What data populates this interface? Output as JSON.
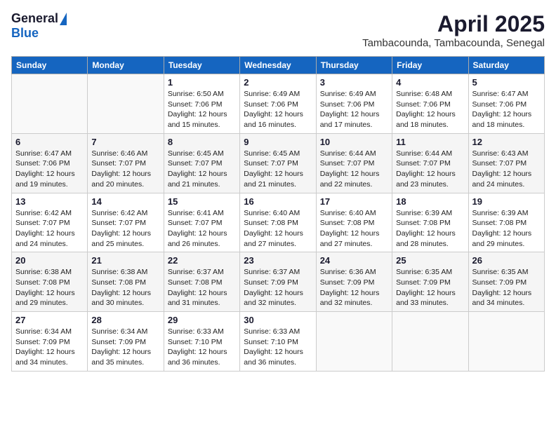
{
  "header": {
    "logo_general": "General",
    "logo_blue": "Blue",
    "title": "April 2025",
    "location": "Tambacounda, Tambacounda, Senegal"
  },
  "weekdays": [
    "Sunday",
    "Monday",
    "Tuesday",
    "Wednesday",
    "Thursday",
    "Friday",
    "Saturday"
  ],
  "weeks": [
    [
      {
        "day": "",
        "info": ""
      },
      {
        "day": "",
        "info": ""
      },
      {
        "day": "1",
        "info": "Sunrise: 6:50 AM\nSunset: 7:06 PM\nDaylight: 12 hours and 15 minutes."
      },
      {
        "day": "2",
        "info": "Sunrise: 6:49 AM\nSunset: 7:06 PM\nDaylight: 12 hours and 16 minutes."
      },
      {
        "day": "3",
        "info": "Sunrise: 6:49 AM\nSunset: 7:06 PM\nDaylight: 12 hours and 17 minutes."
      },
      {
        "day": "4",
        "info": "Sunrise: 6:48 AM\nSunset: 7:06 PM\nDaylight: 12 hours and 18 minutes."
      },
      {
        "day": "5",
        "info": "Sunrise: 6:47 AM\nSunset: 7:06 PM\nDaylight: 12 hours and 18 minutes."
      }
    ],
    [
      {
        "day": "6",
        "info": "Sunrise: 6:47 AM\nSunset: 7:06 PM\nDaylight: 12 hours and 19 minutes."
      },
      {
        "day": "7",
        "info": "Sunrise: 6:46 AM\nSunset: 7:07 PM\nDaylight: 12 hours and 20 minutes."
      },
      {
        "day": "8",
        "info": "Sunrise: 6:45 AM\nSunset: 7:07 PM\nDaylight: 12 hours and 21 minutes."
      },
      {
        "day": "9",
        "info": "Sunrise: 6:45 AM\nSunset: 7:07 PM\nDaylight: 12 hours and 21 minutes."
      },
      {
        "day": "10",
        "info": "Sunrise: 6:44 AM\nSunset: 7:07 PM\nDaylight: 12 hours and 22 minutes."
      },
      {
        "day": "11",
        "info": "Sunrise: 6:44 AM\nSunset: 7:07 PM\nDaylight: 12 hours and 23 minutes."
      },
      {
        "day": "12",
        "info": "Sunrise: 6:43 AM\nSunset: 7:07 PM\nDaylight: 12 hours and 24 minutes."
      }
    ],
    [
      {
        "day": "13",
        "info": "Sunrise: 6:42 AM\nSunset: 7:07 PM\nDaylight: 12 hours and 24 minutes."
      },
      {
        "day": "14",
        "info": "Sunrise: 6:42 AM\nSunset: 7:07 PM\nDaylight: 12 hours and 25 minutes."
      },
      {
        "day": "15",
        "info": "Sunrise: 6:41 AM\nSunset: 7:07 PM\nDaylight: 12 hours and 26 minutes."
      },
      {
        "day": "16",
        "info": "Sunrise: 6:40 AM\nSunset: 7:08 PM\nDaylight: 12 hours and 27 minutes."
      },
      {
        "day": "17",
        "info": "Sunrise: 6:40 AM\nSunset: 7:08 PM\nDaylight: 12 hours and 27 minutes."
      },
      {
        "day": "18",
        "info": "Sunrise: 6:39 AM\nSunset: 7:08 PM\nDaylight: 12 hours and 28 minutes."
      },
      {
        "day": "19",
        "info": "Sunrise: 6:39 AM\nSunset: 7:08 PM\nDaylight: 12 hours and 29 minutes."
      }
    ],
    [
      {
        "day": "20",
        "info": "Sunrise: 6:38 AM\nSunset: 7:08 PM\nDaylight: 12 hours and 29 minutes."
      },
      {
        "day": "21",
        "info": "Sunrise: 6:38 AM\nSunset: 7:08 PM\nDaylight: 12 hours and 30 minutes."
      },
      {
        "day": "22",
        "info": "Sunrise: 6:37 AM\nSunset: 7:08 PM\nDaylight: 12 hours and 31 minutes."
      },
      {
        "day": "23",
        "info": "Sunrise: 6:37 AM\nSunset: 7:09 PM\nDaylight: 12 hours and 32 minutes."
      },
      {
        "day": "24",
        "info": "Sunrise: 6:36 AM\nSunset: 7:09 PM\nDaylight: 12 hours and 32 minutes."
      },
      {
        "day": "25",
        "info": "Sunrise: 6:35 AM\nSunset: 7:09 PM\nDaylight: 12 hours and 33 minutes."
      },
      {
        "day": "26",
        "info": "Sunrise: 6:35 AM\nSunset: 7:09 PM\nDaylight: 12 hours and 34 minutes."
      }
    ],
    [
      {
        "day": "27",
        "info": "Sunrise: 6:34 AM\nSunset: 7:09 PM\nDaylight: 12 hours and 34 minutes."
      },
      {
        "day": "28",
        "info": "Sunrise: 6:34 AM\nSunset: 7:09 PM\nDaylight: 12 hours and 35 minutes."
      },
      {
        "day": "29",
        "info": "Sunrise: 6:33 AM\nSunset: 7:10 PM\nDaylight: 12 hours and 36 minutes."
      },
      {
        "day": "30",
        "info": "Sunrise: 6:33 AM\nSunset: 7:10 PM\nDaylight: 12 hours and 36 minutes."
      },
      {
        "day": "",
        "info": ""
      },
      {
        "day": "",
        "info": ""
      },
      {
        "day": "",
        "info": ""
      }
    ]
  ]
}
